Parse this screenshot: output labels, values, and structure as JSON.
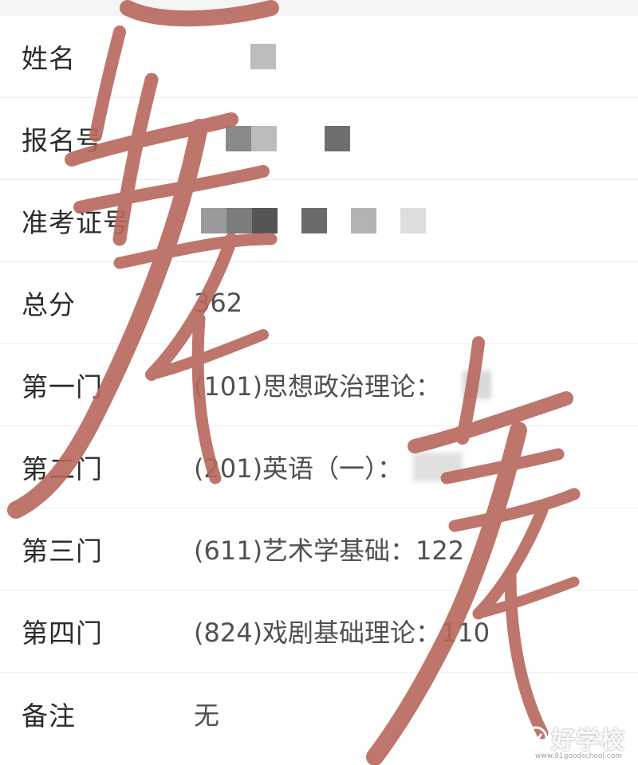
{
  "rows": [
    {
      "label": "姓名",
      "value": ""
    },
    {
      "label": "报名号",
      "value": ""
    },
    {
      "label": "准考证号",
      "value": ""
    },
    {
      "label": "总分",
      "value": "362"
    },
    {
      "label": "第一门",
      "value": "(101)思想政治理论："
    },
    {
      "label": "第二门",
      "value": "(201)英语（一）："
    },
    {
      "label": "第三门",
      "value": "(611)艺术学基础：122"
    },
    {
      "label": "第四门",
      "value": "(824)戏剧基础理论：110"
    },
    {
      "label": "备注",
      "value": "无"
    }
  ],
  "watermark": {
    "logo_text": "好学校",
    "logo_sub": "www.91goodschool.com",
    "stroke_color": "#b8675c"
  },
  "icons": {
    "logo": "school-logo-icon"
  }
}
